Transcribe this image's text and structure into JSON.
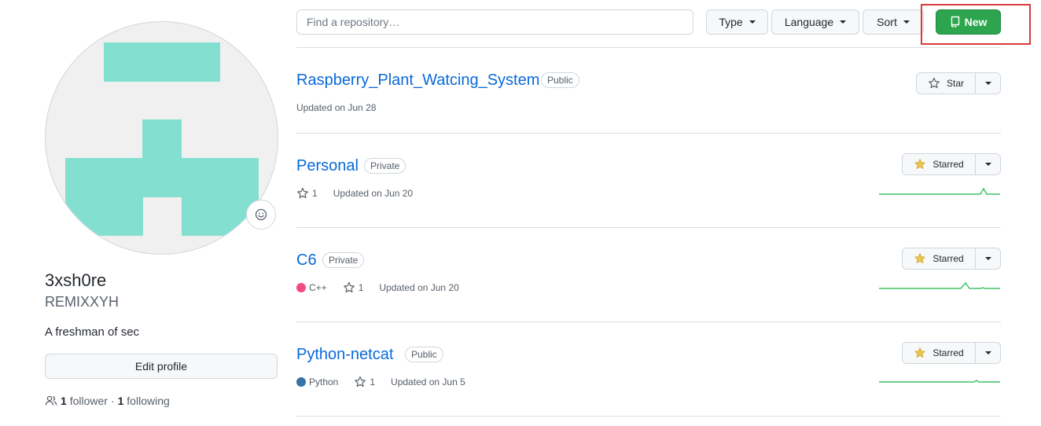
{
  "profile": {
    "full_name": "3xsh0re",
    "username": "REMIXXYH",
    "bio": "A freshman of sec",
    "edit_label": "Edit profile",
    "followers_count": "1",
    "followers_label": "follower",
    "separator": "·",
    "following_count": "1",
    "following_label": "following"
  },
  "filters": {
    "search_placeholder": "Find a repository…",
    "type_label": "Type",
    "language_label": "Language",
    "sort_label": "Sort",
    "new_label": "New"
  },
  "repos": [
    {
      "name": "Raspberry_Plant_Watcing_System",
      "visibility": "Public",
      "updated": "Updated on Jun 28",
      "star_label": "Star",
      "starred": false
    },
    {
      "name": "Personal",
      "visibility": "Private",
      "stars": "1",
      "updated": "Updated on Jun 20",
      "star_label": "Starred",
      "starred": true
    },
    {
      "name": "C6",
      "visibility": "Private",
      "language": "C++",
      "language_color": "#f34b7d",
      "stars": "1",
      "updated": "Updated on Jun 20",
      "star_label": "Starred",
      "starred": true
    },
    {
      "name": "Python-netcat",
      "visibility": "Public",
      "language": "Python",
      "language_color": "#3572A5",
      "stars": "1",
      "updated": "Updated on Jun 5",
      "star_label": "Starred",
      "starred": true
    }
  ],
  "colors": {
    "link": "#0969da",
    "new_button": "#2da44e",
    "avatar_pattern": "#83e0d1",
    "starred_icon": "#eac54f",
    "sparkline": "#40c463",
    "highlight_box": "#d73a3a"
  }
}
